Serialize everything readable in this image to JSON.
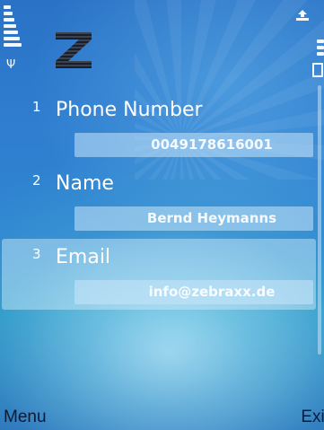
{
  "status": {
    "signal_icon": "signal-strength-icon",
    "antenna_icon": "antenna-icon",
    "battery_icon": "battery-icon",
    "top_right_icon": "data-transfer-icon"
  },
  "app": {
    "logo_icon": "zebraxx-z-logo"
  },
  "list": {
    "items": [
      {
        "number": "1",
        "label": "Phone Number",
        "value": "0049178616001"
      },
      {
        "number": "2",
        "label": "Name",
        "value": "Bernd Heymanns"
      },
      {
        "number": "3",
        "label": "Email",
        "value": "info@zebraxx.de"
      }
    ],
    "selected_index": 3
  },
  "softkeys": {
    "left": "Menu",
    "right": "Exit"
  },
  "colors": {
    "background_top": "#2a72c6",
    "background_bottom": "#2a6fb8",
    "text": "#ffffff",
    "softkey_text": "#0d1a36"
  }
}
